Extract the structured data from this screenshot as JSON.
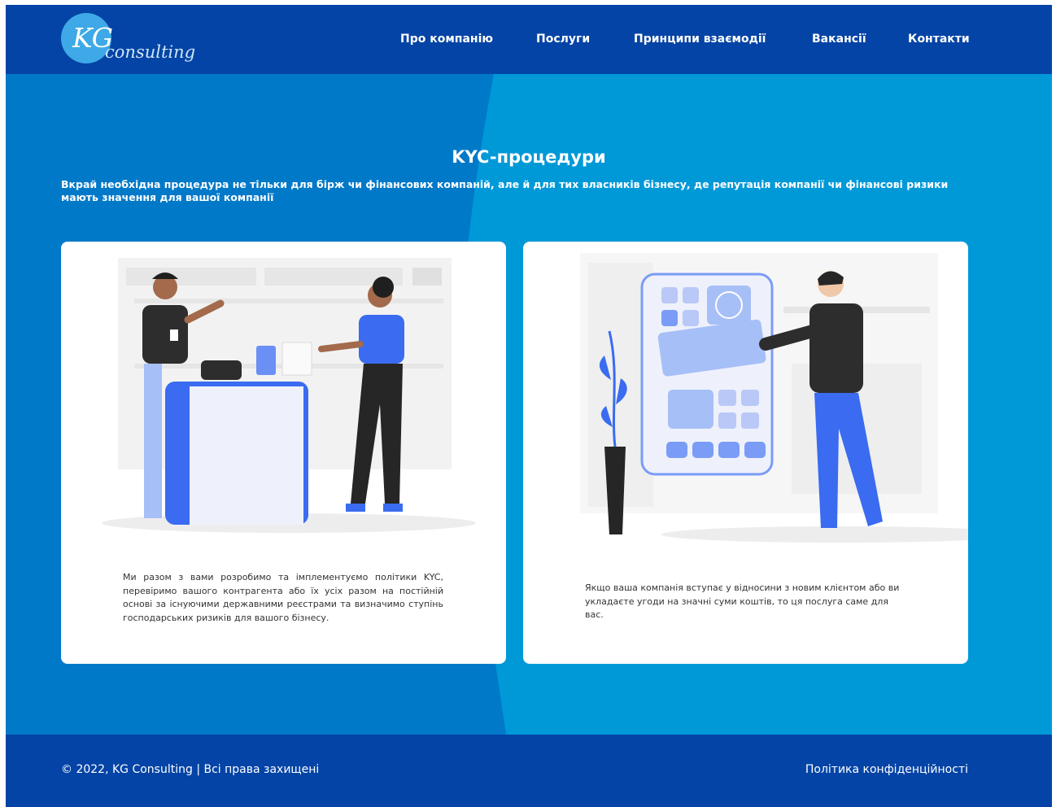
{
  "header": {
    "logo": {
      "mark": "KG",
      "wordmark": "consulting"
    },
    "nav": [
      {
        "label": "Про компанію"
      },
      {
        "label": "Послуги"
      },
      {
        "label": "Принципи взаємодії"
      },
      {
        "label": "Вакансії"
      },
      {
        "label": "Контакти"
      }
    ]
  },
  "hero": {
    "title": "KYC-процедури",
    "intro": "Вкрай необхідна процедура не тільки для бірж чи фінансових компаній, але й для тих власників бізнесу, де репутація компанії чи фінансові ризики мають значення для вашої компанії"
  },
  "cards": [
    {
      "illustration": "kyc-desk-illustration",
      "text": "Ми разом з вами розробимо та імплементуємо політики KYC, перевіримо вашого контрагента або їх усіх разом на постійній основі за існуючими державними реєстрами та визначимо ступінь господарських ризиків для вашого бізнесу."
    },
    {
      "illustration": "phone-app-illustration",
      "text": "Якщо ваша компанія вступає у відносини з новим клієнтом або ви укладаєте угоди на значні суми коштів, то ця послуга саме для вас."
    }
  ],
  "footer": {
    "copyright": "© 2022, KG Consulting | Всі права захищені",
    "policy": "Політика конфіденційності"
  },
  "colors": {
    "header_bg": "#0444a6",
    "hero_dark": "#0079c9",
    "hero_light": "#0099d8",
    "accent_blue": "#3a6bf0",
    "white": "#ffffff"
  }
}
